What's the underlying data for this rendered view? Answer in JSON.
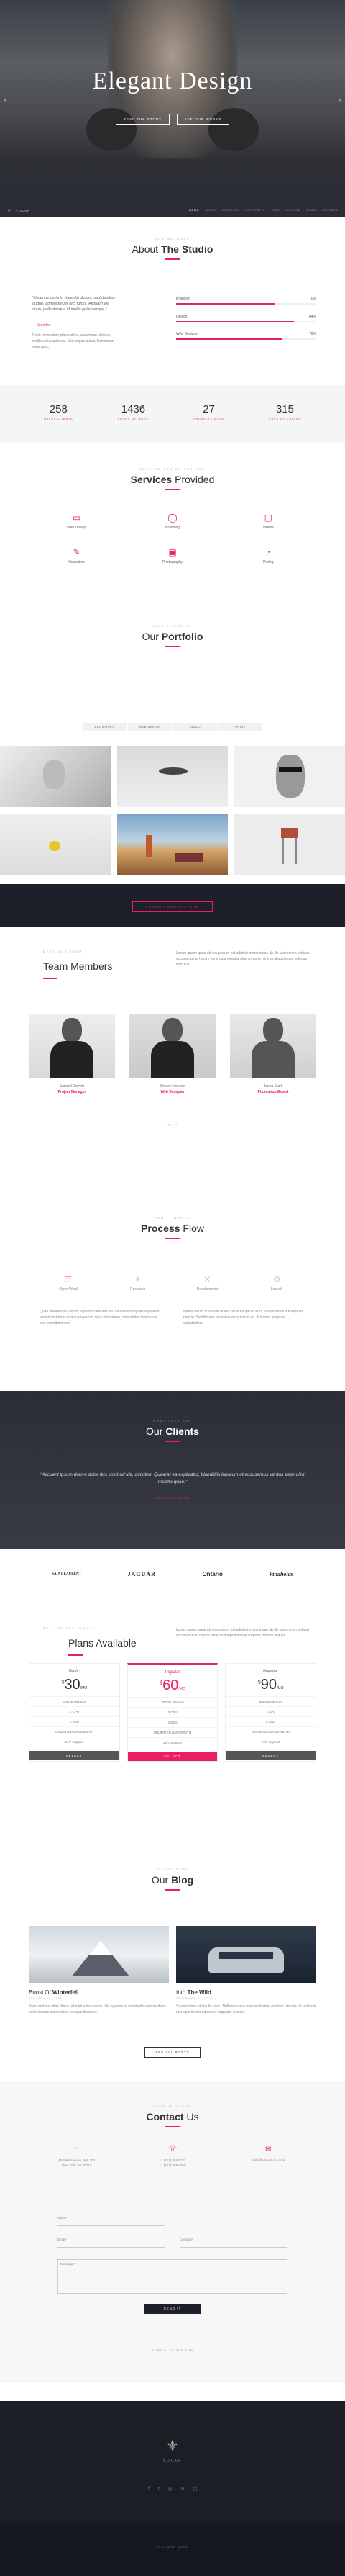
{
  "hero": {
    "title": "Elegant Design",
    "btn1": "READ THE STORY",
    "btn2": "SEE OUR WORKS"
  },
  "nav": {
    "brand": "VOLAR",
    "items": [
      "HOME",
      "ABOUT",
      "SERVICES",
      "PORTFOLIO",
      "TEAM",
      "PRICING",
      "BLOG",
      "CONTACT"
    ]
  },
  "about": {
    "pre": "HOW WE WORK",
    "title_a": "About",
    "title_b": "The Studio",
    "quote": "\"Vivamus porta in vitae dui dictum, sed dapibus augue, consectetuer orci turpis. Aliquam vel diam, pellentesque id mollis pellentesque.\"",
    "author": "— Jennifer",
    "text": "Proin fermentum placerat leo, accumsan ultricies, mollis varius pulvinar. Sed augue purus, fermentum vitae nunc.",
    "skills": [
      {
        "name": "Branding",
        "pct": "70%",
        "v": 0.7
      },
      {
        "name": "Design",
        "pct": "84%",
        "v": 0.84
      },
      {
        "name": "Web Designs",
        "pct": "76%",
        "v": 0.76
      }
    ]
  },
  "stats": [
    {
      "n": "258",
      "l": "HAPPY CLIENTS"
    },
    {
      "n": "1436",
      "l": "HOURS OF WORK"
    },
    {
      "n": "27",
      "l": "PROJECTS DONE"
    },
    {
      "n": "315",
      "l": "CUPS OF COFFEE"
    }
  ],
  "services": {
    "pre": "WHAT WE CAN DO FOR YOU",
    "title_a": "Services",
    "title_b": "Provided",
    "items": [
      "Web Design",
      "Branding",
      "Videos",
      "Illustration",
      "Photography",
      "Prolog"
    ]
  },
  "portfolio": {
    "pre": "TAKE A LOOK AT",
    "title_a": "Our",
    "title_b": "Portfolio",
    "filters": [
      "ALL WORKS",
      "WEB DESIGN",
      "VIDEO",
      "PRINT"
    ]
  },
  "cta": {
    "label": "CONTACT PROJECT NOW"
  },
  "team": {
    "pre": "MEET OUR TEAM",
    "title_a": "Team",
    "title_b": "Members",
    "text": "Lorem ipsum quae ab voluptatum est adipisci moreniquae ab illo autem non a datas accusamus at harum kone quis repudiandae corporis minima aliquid quod saleque ridiculus.",
    "members": [
      {
        "name": "Samuel Denver",
        "role": "Project Manager"
      },
      {
        "name": "Steven Monroe",
        "role": "Web Designer"
      },
      {
        "name": "Janna Stark",
        "role": "Photoshop Expert"
      }
    ]
  },
  "process": {
    "pre": "HOW IT WORKS",
    "title_a": "Process",
    "title_b": "Flow",
    "steps": [
      "Open Word",
      "Research",
      "Development",
      "Launch"
    ],
    "p1": "Quae dolorem aut rerum expedita nesciunt ea. Laboriosam quaeratquaestio veniam est error numquam earum quis voluptatem consectetur totam quia sed exercitationem.",
    "p2": "Nemo ipsum quae sed omnis laborum ipsum et ut. Voluptatibus aut aliquam nam in. Sed illo eos excepturi error ipsum ad. Aut amet tempore voluptatibus."
  },
  "clients": {
    "pre": "WHAT THEY SAY",
    "title_a": "Our",
    "title_b": "Clients",
    "quote": "\"Accuent ipsum dolore dolor itus volut ad ide, quisdem Quaerat ea explicabo, blandiitiis laborum ut accusamus veritas esse ullor mollitia quae.\"",
    "author": "JENNIFER STARK",
    "logos": [
      "SAINT LAURENT",
      "JAGUAR",
      "Ontario",
      "Pinaholas"
    ]
  },
  "plans": {
    "pre": "PRICING AND PLANS",
    "title_a": "Plans",
    "title_b": "Available",
    "text": "Lorem ipsum quae ab voluptatum est adipisci moreniquae ab illo autem non a datas accusamus at harum kone quis repudiandae corporis minima aliquid.",
    "items": [
      {
        "name": "Basic",
        "price": "30",
        "per": "/MO",
        "f": [
          "100GB Memory",
          "1 CPU",
          "2 SSD",
          "UNLIMITED BANDWIDTH",
          "24/7 Support"
        ],
        "btn": "SELECT"
      },
      {
        "name": "Popular",
        "price": "60",
        "per": "/MO",
        "f": [
          "200GB Memory",
          "2 CPU",
          "4 SSD",
          "UNLIMITED BANDWIDTH",
          "24/7 Support"
        ],
        "btn": "SELECT"
      },
      {
        "name": "Premier",
        "price": "90",
        "per": "/MO",
        "f": [
          "500GB Memory",
          "4 CPU",
          "8 SSD",
          "UNLIMITED BANDWIDTH",
          "24/7 Support"
        ],
        "btn": "SELECT"
      }
    ]
  },
  "blog": {
    "pre": "LATEST NEWS",
    "title_a": "Our",
    "title_b": "Blog",
    "posts": [
      {
        "t_a": "Bunsi Of",
        "t_b": "Winterfell",
        "meta": "JANUARY 15, 2016",
        "text": "Nunc sed nisi vitae libero vel metus luctus non. Vel egestas ut commodo semper diam pellentesque consectetur leo quis tincidunt."
      },
      {
        "t_a": "Into",
        "t_b": "The Wild",
        "meta": "DECEMBER 03, 2015",
        "text": "Suspendisse et iaculis nunc. Nullam cursus massa sit amet porttitor ultricies. In vehicula ut neque id bibendum vel vulputate in arcu."
      }
    ],
    "more": "SEE ALL POSTS"
  },
  "contact": {
    "pre": "KEEP IN TOUCH",
    "title_a": "Contact",
    "title_b": "Us",
    "info": [
      "45 Park Avenue, Apt. 303\nNew York, NY 10016",
      "+1 (212) 555-0123\n+1 (212) 555-0456",
      "hello@volarstudio.com"
    ],
    "name": "Name*",
    "email": "Email*",
    "company": "Company",
    "message": "Message*",
    "send": "SEND IT"
  },
  "scrolltop": "SCROLL TO THE TOP",
  "footer": {
    "brand": "VOLAR",
    "copy": "© VOLAR 2016"
  }
}
